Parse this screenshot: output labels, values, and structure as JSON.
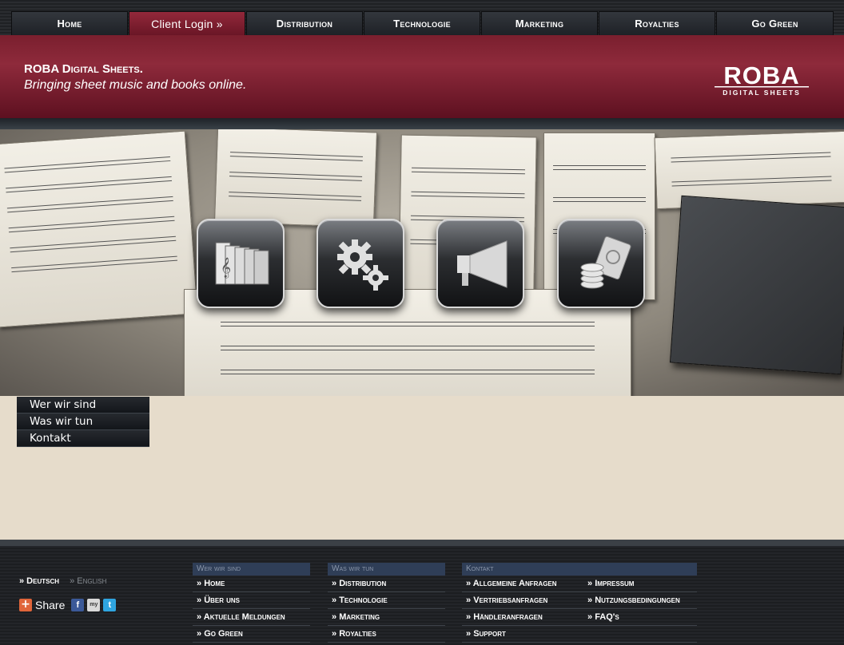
{
  "nav": [
    {
      "label": "Home",
      "name": "home"
    },
    {
      "label": "Client Login »",
      "name": "client-login",
      "active": true
    },
    {
      "label": "Distribution",
      "name": "distribution"
    },
    {
      "label": "Technologie",
      "name": "technologie"
    },
    {
      "label": "Marketing",
      "name": "marketing"
    },
    {
      "label": "Royalties",
      "name": "royalties"
    },
    {
      "label": "Go Green",
      "name": "go-green"
    }
  ],
  "brand": {
    "line1": "ROBA Digital Sheets.",
    "line2": "Bringing sheet music and books online.",
    "logo_top": "ROBA",
    "logo_bottom": "DIGITAL SHEETS",
    "color": "#8e2a3b"
  },
  "hero_buttons": [
    {
      "icon": "sheet-music-stack-icon"
    },
    {
      "icon": "gears-icon"
    },
    {
      "icon": "megaphone-icon"
    },
    {
      "icon": "coins-banknotes-icon"
    }
  ],
  "subnav": [
    "Wer wir sind",
    "Was wir tun",
    "Kontakt"
  ],
  "footer": {
    "lang_de": "» Deutsch",
    "lang_en": "» English",
    "share_label": "Share",
    "col1": {
      "head": "Wer wir sind",
      "items": [
        "Home",
        "Über uns",
        "Aktuelle Meldungen",
        "Go Green"
      ]
    },
    "col2": {
      "head": "Was wir tun",
      "items": [
        "Distribution",
        "Technologie",
        "Marketing",
        "Royalties"
      ]
    },
    "col3": {
      "head": "Kontakt",
      "items": [
        "Allgemeine Anfragen",
        "Vertriebsanfragen",
        "Händleranfragen",
        "Support"
      ],
      "items2": [
        "Impressum",
        "Nutzungsbedingungen",
        "FAQ's"
      ]
    }
  }
}
